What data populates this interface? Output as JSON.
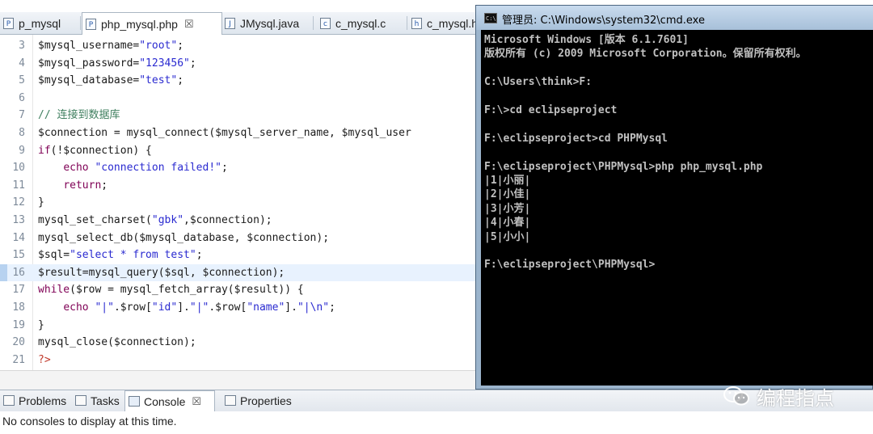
{
  "editor": {
    "tabs": [
      {
        "label": "p_mysql",
        "icon": "php-file-icon"
      },
      {
        "label": "php_mysql.php",
        "icon": "php-file-icon",
        "close": "☒"
      },
      {
        "label": "JMysql.java",
        "icon": "java-file-icon"
      },
      {
        "label": "c_mysql.c",
        "icon": "c-file-icon"
      },
      {
        "label": "c_mysql.h",
        "icon": "c-header-icon"
      }
    ],
    "highlighted_line": 16,
    "lines": [
      {
        "num": "3",
        "text": "$mysql_username=\"root\";"
      },
      {
        "num": "4",
        "text": "$mysql_password=\"123456\";"
      },
      {
        "num": "5",
        "text": "$mysql_database=\"test\";"
      },
      {
        "num": "6",
        "text": ""
      },
      {
        "num": "7",
        "text": "// 连接到数据库"
      },
      {
        "num": "8",
        "text": "$connection = mysql_connect($mysql_server_name, $mysql_user"
      },
      {
        "num": "9",
        "text": "if(!$connection) {"
      },
      {
        "num": "10",
        "text": "    echo \"connection failed!\";"
      },
      {
        "num": "11",
        "text": "    return;"
      },
      {
        "num": "12",
        "text": "}"
      },
      {
        "num": "13",
        "text": "mysql_set_charset(\"gbk\",$connection);"
      },
      {
        "num": "14",
        "text": "mysql_select_db($mysql_database, $connection);"
      },
      {
        "num": "15",
        "text": "$sql=\"select * from test\";"
      },
      {
        "num": "16",
        "text": "$result=mysql_query($sql, $connection);"
      },
      {
        "num": "17",
        "text": "while($row = mysql_fetch_array($result)) {"
      },
      {
        "num": "18",
        "text": "    echo \"|\".$row[\"id\"].\"|\".$row[\"name\"].\"|\\n\";"
      },
      {
        "num": "19",
        "text": "}"
      },
      {
        "num": "20",
        "text": "mysql_close($connection);"
      },
      {
        "num": "21",
        "text": "?>"
      }
    ]
  },
  "panel": {
    "tabs": [
      {
        "label": "Problems",
        "icon": "problems-icon"
      },
      {
        "label": "Tasks",
        "icon": "tasks-icon"
      },
      {
        "label": "Console",
        "icon": "console-icon",
        "close": "☒"
      },
      {
        "label": "Properties",
        "icon": "properties-icon"
      }
    ],
    "message": "No consoles to display at this time."
  },
  "cmd": {
    "title": "管理员: C:\\Windows\\system32\\cmd.exe",
    "icon_text": "C:\\",
    "lines": [
      "Microsoft Windows [版本 6.1.7601]",
      "版权所有 (c) 2009 Microsoft Corporation。保留所有权利。",
      "",
      "C:\\Users\\think>F:",
      "",
      "F:\\>cd eclipseproject",
      "",
      "F:\\eclipseproject>cd PHPMysql",
      "",
      "F:\\eclipseproject\\PHPMysql>php php_mysql.php",
      "|1|小丽|",
      "|2|小佳|",
      "|3|小芳|",
      "|4|小春|",
      "|5|小小|",
      "",
      "F:\\eclipseproject\\PHPMysql>"
    ]
  },
  "watermark": {
    "text": "编程指点",
    "icon": "wechat-icon"
  },
  "colors": {
    "string": "#2a2ad0",
    "comment": "#3f7f5f",
    "keyword": "#7f0055",
    "php_tag": "#c0392b",
    "highlight": "#e8f2fe",
    "console_bg": "#000000",
    "console_text": "#c0c0c0"
  }
}
